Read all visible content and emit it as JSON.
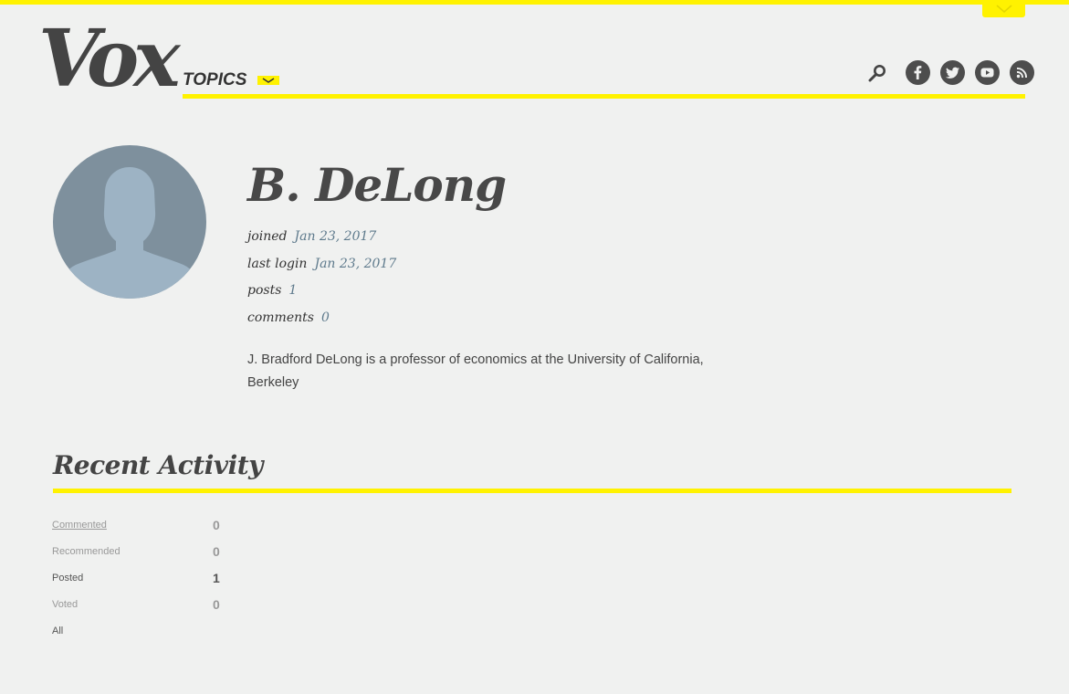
{
  "header": {
    "logo_text": "Vox",
    "topics_label": "TOPICS",
    "icons": [
      "chevron-down-icon",
      "search-icon",
      "facebook-icon",
      "twitter-icon",
      "youtube-icon",
      "rss-icon"
    ]
  },
  "colors": {
    "accent": "#fff200",
    "background": "#f0f1f0",
    "text": "#444444",
    "meta_value": "#5e7a8c",
    "avatar_bg": "#7e909d",
    "avatar_silhouette": "#9db3c4"
  },
  "profile": {
    "name": "B. DeLong",
    "meta": [
      {
        "label": "joined",
        "value": "Jan 23, 2017"
      },
      {
        "label": "last login",
        "value": "Jan 23, 2017"
      },
      {
        "label": "posts",
        "value": "1"
      },
      {
        "label": "comments",
        "value": "0"
      }
    ],
    "bio": "J. Bradford DeLong is a professor of economics at the University of California, Berkeley"
  },
  "activity": {
    "title": "Recent Activity",
    "items": [
      {
        "label": "Commented",
        "count": "0"
      },
      {
        "label": "Recommended",
        "count": "0"
      },
      {
        "label": "Posted",
        "count": "1"
      },
      {
        "label": "Voted",
        "count": "0"
      },
      {
        "label": "All",
        "count": ""
      }
    ]
  }
}
